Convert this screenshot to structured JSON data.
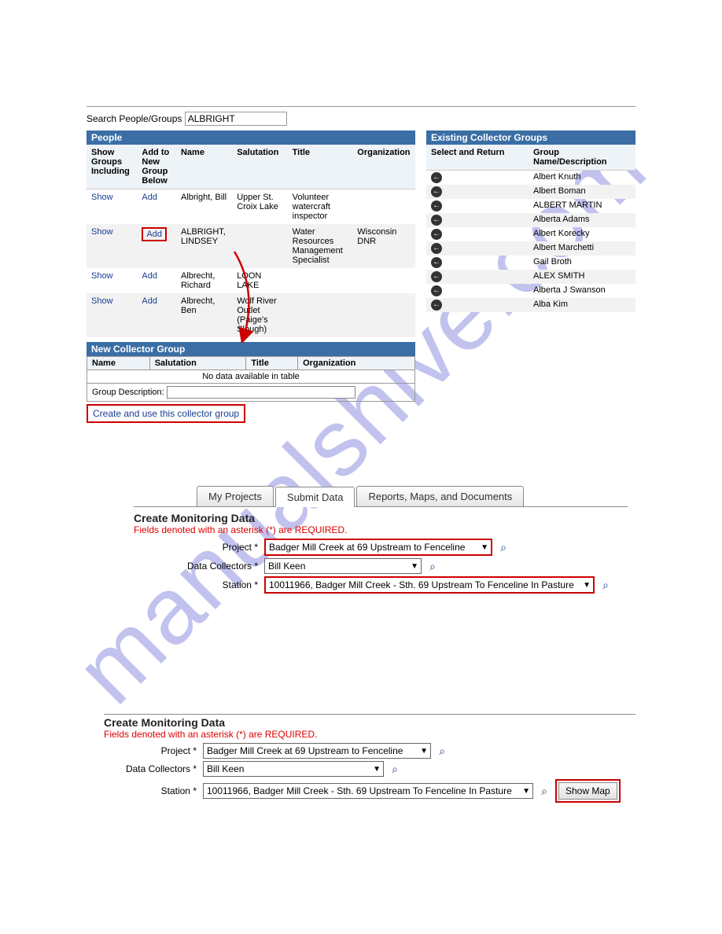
{
  "watermark": "manualshive.com",
  "search": {
    "label": "Search People/Groups",
    "value": "ALBRIGHT"
  },
  "people": {
    "header": "People",
    "columns": {
      "show": "Show Groups Including",
      "add": "Add to New Group Below",
      "name": "Name",
      "salutation": "Salutation",
      "title": "Title",
      "org": "Organization"
    },
    "show_link": "Show",
    "add_link": "Add",
    "rows": [
      {
        "name": "Albright, Bill",
        "salutation": "Upper St. Croix Lake",
        "title": "Volunteer watercraft inspector",
        "org": ""
      },
      {
        "name": "ALBRIGHT, LINDSEY",
        "salutation": "",
        "title": "Water Resources Management Specialist",
        "org": "Wisconsin DNR",
        "highlight_add": true
      },
      {
        "name": "Albrecht, Richard",
        "salutation": "LOON LAKE",
        "title": "",
        "org": ""
      },
      {
        "name": "Albrecht, Ben",
        "salutation": "Wolf River Outlet (Paige's Slough)",
        "title": "",
        "org": ""
      }
    ]
  },
  "new_group": {
    "header": "New Collector Group",
    "cols": {
      "name": "Name",
      "salutation": "Salutation",
      "title": "Title",
      "org": "Organization"
    },
    "nodata": "No data available in table",
    "desc_label": "Group Description:",
    "desc_value": "",
    "create_link": "Create and use this collector group"
  },
  "existing": {
    "header": "Existing Collector Groups",
    "cols": {
      "select": "Select and Return",
      "name": "Group Name/Description"
    },
    "rows": [
      "Albert Knuth",
      "Albert Boman",
      "ALBERT MARTIN",
      "Alberta Adams",
      "Albert Korecky",
      "Albert Marchetti",
      "Gail Broth",
      "ALEX SMITH",
      "Alberta J Swanson",
      "Alba Kim"
    ]
  },
  "tabs": {
    "my_projects": "My Projects",
    "submit_data": "Submit Data",
    "reports": "Reports, Maps, and Documents"
  },
  "form": {
    "title": "Create Monitoring Data",
    "required_note": "Fields denoted with an asterisk (*) are REQUIRED.",
    "labels": {
      "project": "Project *",
      "collectors": "Data Collectors *",
      "station": "Station *"
    },
    "values": {
      "project": "Badger Mill Creek at 69 Upstream to Fenceline",
      "collectors": "Bill Keen",
      "station": "10011966, Badger Mill Creek - Sth. 69 Upstream To Fenceline In Pasture"
    },
    "show_map": "Show Map"
  }
}
